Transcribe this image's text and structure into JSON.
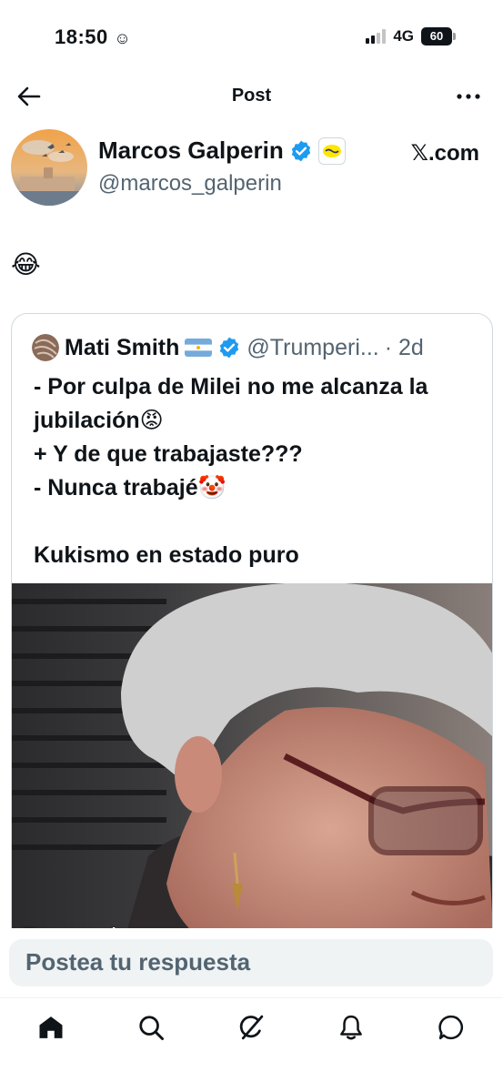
{
  "status_bar": {
    "time": "18:50",
    "network": "4G",
    "battery": "60"
  },
  "header": {
    "title": "Post",
    "back_icon": "arrow-left-icon",
    "more_icon": "more-horizontal-icon"
  },
  "post": {
    "author_name": "Marcos Galperin",
    "author_handle": "@marcos_galperin",
    "source_label": "𝕏.com",
    "text": "😂"
  },
  "quote": {
    "author_name": "Mati Smith",
    "author_handle": "@Trumperi...",
    "time": "· 2d",
    "body": "- Por culpa de Milei no me alcanza la jubilación😡\n+ Y de que trabajaste???\n- Nunca trabajé🤡\n\nKukismo en estado puro",
    "media_watermark": "Trumperizar"
  },
  "reply": {
    "placeholder": "Postea tu respuesta"
  },
  "nav": {
    "items": [
      "home-icon",
      "search-icon",
      "grok-icon",
      "notifications-icon",
      "messages-icon"
    ]
  },
  "colors": {
    "verified": "#1d9bf0",
    "secondary_text": "#536471",
    "border": "#cfd9de"
  }
}
